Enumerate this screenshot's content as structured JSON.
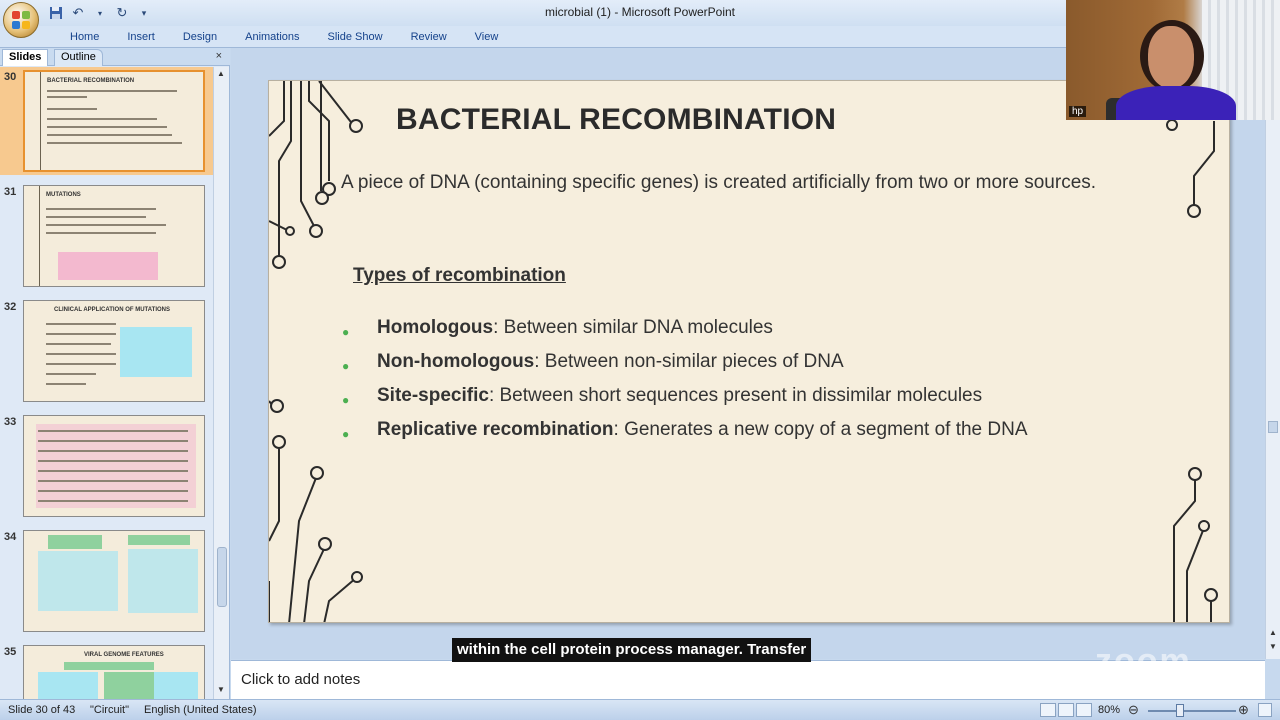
{
  "window": {
    "title": "microbial (1) - Microsoft PowerPoint"
  },
  "ribbon": {
    "tabs": [
      "Home",
      "Insert",
      "Design",
      "Animations",
      "Slide Show",
      "Review",
      "View"
    ]
  },
  "left_pane": {
    "tabs": {
      "slides": "Slides",
      "outline": "Outline"
    },
    "close": "×",
    "thumbnails": [
      {
        "number": "30",
        "title": "BACTERIAL RECOMBINATION",
        "selected": true
      },
      {
        "number": "31",
        "title": "MUTATIONS",
        "selected": false
      },
      {
        "number": "32",
        "title": "CLINICAL APPLICATION OF MUTATIONS",
        "selected": false
      },
      {
        "number": "33",
        "title": "",
        "selected": false
      },
      {
        "number": "34",
        "title": "",
        "selected": false
      },
      {
        "number": "35",
        "title": "VIRAL GENOME FEATURES",
        "selected": false
      }
    ]
  },
  "slide": {
    "title": "BACTERIAL RECOMBINATION",
    "intro": "A piece of DNA (containing specific genes) is created artificially from two or more sources.",
    "subheading": "Types of recombination",
    "items": [
      {
        "term": "Homologous",
        "desc": ": Between similar DNA molecules"
      },
      {
        "term": "Non-homologous",
        "desc": ": Between non-similar pieces of DNA"
      },
      {
        "term": "Site-specific",
        "desc": ": Between short sequences present in dissimilar molecules"
      },
      {
        "term": "Replicative recombination",
        "desc": ": Generates a new copy of a segment of the DNA"
      }
    ]
  },
  "caption": "within the cell protein process manager. Transfer",
  "notes": {
    "placeholder": "Click to add notes"
  },
  "status": {
    "slide_of": "Slide 30 of 43",
    "theme": "\"Circuit\"",
    "language": "English (United States)",
    "zoom": "80%"
  },
  "webcam": {
    "label": "hp"
  },
  "watermark": "zoom",
  "colors": {
    "ribbon_text": "#15428b",
    "bullet": "#4caf50",
    "selected_thumb": "#f7c98f",
    "slide_bg": "#f6eedd"
  }
}
